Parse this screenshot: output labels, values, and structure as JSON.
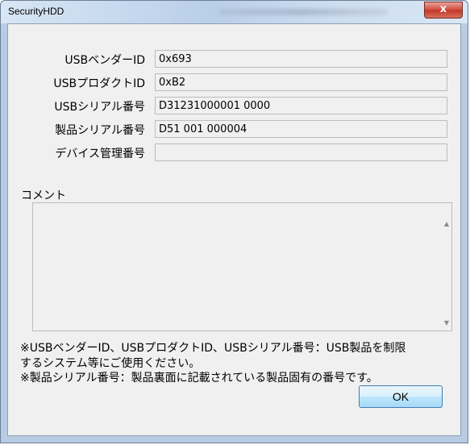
{
  "window": {
    "title": "SecurityHDD",
    "close_label": "x"
  },
  "fields": [
    {
      "label": "USBベンダーID",
      "value": "0x693"
    },
    {
      "label": "USBプロダクトID",
      "value": "0xB2"
    },
    {
      "label": "USBシリアル番号",
      "value": "D31231000001 0000"
    },
    {
      "label": "製品シリアル番号",
      "value": "D51 001 000004"
    },
    {
      "label": "デバイス管理番号",
      "value": ""
    }
  ],
  "comment": {
    "label": "コメント",
    "value": ""
  },
  "notes": [
    "※USBベンダーID、USBプロダクトID、USBシリアル番号：USB製品を制限",
    "するシステム等にご使用ください。",
    "※製品シリアル番号：製品裏面に記載されている製品固有の番号です。"
  ],
  "buttons": {
    "ok": "OK"
  }
}
